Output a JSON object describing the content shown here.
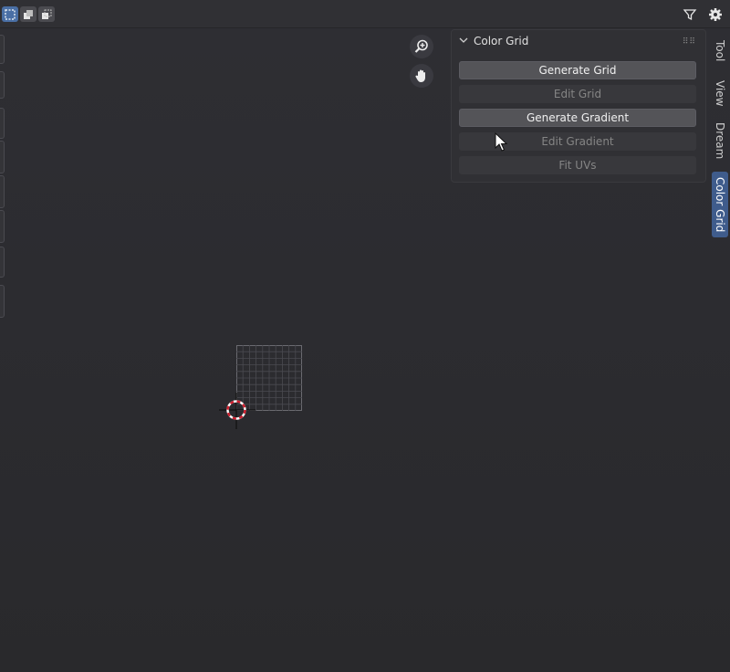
{
  "header": {
    "select_modes": [
      "select-box-icon",
      "select-extend-icon",
      "select-subtract-icon"
    ],
    "filter_icon": "funnel-icon",
    "gizmo_icon": "gear-icon"
  },
  "viewport_nav": {
    "zoom_icon": "zoom-icon",
    "pan_icon": "hand-icon"
  },
  "panel": {
    "title": "Color Grid",
    "buttons": [
      {
        "label": "Generate Grid",
        "enabled": true
      },
      {
        "label": "Edit Grid",
        "enabled": false
      },
      {
        "label": "Generate Gradient",
        "enabled": true
      },
      {
        "label": "Edit Gradient",
        "enabled": false
      },
      {
        "label": "Fit UVs",
        "enabled": false
      }
    ]
  },
  "sidebar_tabs": [
    {
      "label": "Tool",
      "active": false
    },
    {
      "label": "View",
      "active": false
    },
    {
      "label": "Dream",
      "active": false
    },
    {
      "label": "Color Grid",
      "active": true
    }
  ],
  "colors": {
    "accent": "#4a6fa5",
    "active_tab": "#3f5c8c",
    "cursor_red": "#d01c2c"
  }
}
